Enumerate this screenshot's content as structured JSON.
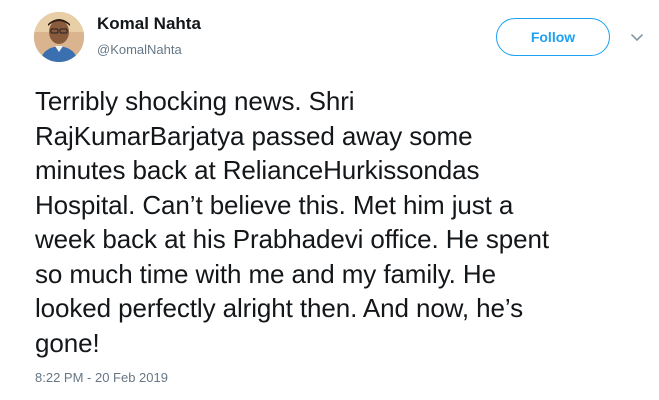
{
  "user": {
    "display_name": "Komal Nahta",
    "handle": "@KomalNahta",
    "avatar_icon": "profile-photo"
  },
  "actions": {
    "follow_label": "Follow",
    "menu_icon": "chevron-down-icon"
  },
  "tweet": {
    "text": "Terribly shocking news. Shri\nRajKumarBarjatya passed away some\nminutes back at RelianceHurkissondas\nHospital. Can’t believe this. Met him just a\nweek back at his Prabhadevi office. He spent\nso much time with me and my family. He\nlooked perfectly alright then. And now, he’s\ngone!",
    "timestamp": "8:22 PM - 20 Feb 2019"
  },
  "colors": {
    "accent": "#1da1f2",
    "text": "#14171a",
    "muted": "#657786"
  }
}
